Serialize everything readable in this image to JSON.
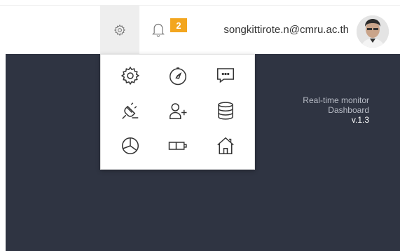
{
  "header": {
    "notification_count": "2",
    "user_email": "songkittirote.n@cmru.ac.th"
  },
  "app_info": {
    "line1": "Real-time monitor",
    "line2": "Dashboard",
    "version": "v.1.3"
  },
  "menu": {
    "items": [
      {
        "icon": "gear-icon"
      },
      {
        "icon": "compass-icon"
      },
      {
        "icon": "chat-bubble-icon"
      },
      {
        "icon": "plug-icon"
      },
      {
        "icon": "add-user-icon"
      },
      {
        "icon": "database-icon"
      },
      {
        "icon": "pie-chart-icon"
      },
      {
        "icon": "battery-icon"
      },
      {
        "icon": "home-icon"
      }
    ]
  },
  "colors": {
    "badge": "#f3a61f",
    "main_background": "#2f3442",
    "settings_active": "#eeeeee"
  }
}
